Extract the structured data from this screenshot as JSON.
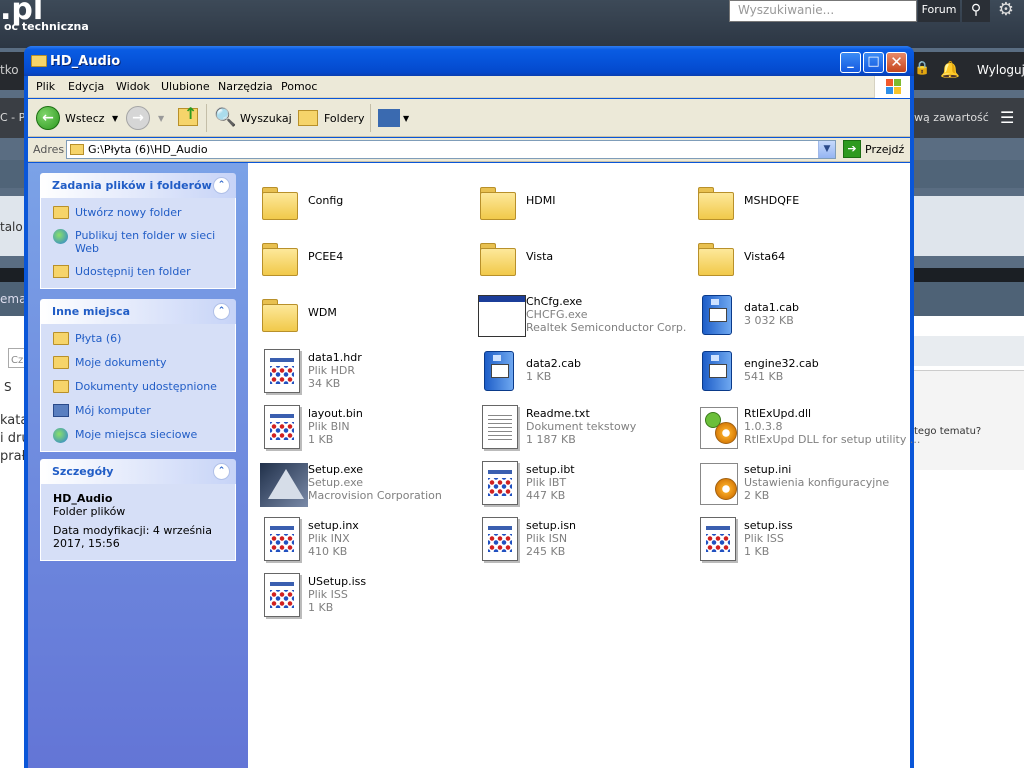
{
  "background_page": {
    "logo_text": ".pl",
    "logo_subtext": "oc techniczna",
    "search_placeholder": "Wyszukiwanie...",
    "forum_button": "Forum",
    "nav_left_text": "tko",
    "logout": "Wyloguj",
    "nav2_left_text": "C - Po",
    "nav2_right_text": "wą zawartość",
    "content_a_text": "talo",
    "stripe2_text": "ema",
    "left_snippet_1": "Cz",
    "left_snippet_2": "S",
    "left_snippet_3": "kata",
    "left_snippet_4": "i dru",
    "left_snippet_5": "prał",
    "right_snippet": "tego tematu?"
  },
  "window": {
    "title": "HD_Audio",
    "menu": [
      "Plik",
      "Edycja",
      "Widok",
      "Ulubione",
      "Narzędzia",
      "Pomoc"
    ],
    "toolbar": {
      "back": "Wstecz",
      "search": "Wyszukaj",
      "folders": "Foldery"
    },
    "address": {
      "label": "Adres",
      "path": "G:\\Płyta (6)\\HD_Audio",
      "go": "Przejdź"
    },
    "taskpane": {
      "file_tasks": {
        "title": "Zadania plików i folderów",
        "items": [
          "Utwórz nowy folder",
          "Publikuj ten folder w sieci Web",
          "Udostępnij ten folder"
        ]
      },
      "other_places": {
        "title": "Inne miejsca",
        "items": [
          "Płyta (6)",
          "Moje dokumenty",
          "Dokumenty udostępnione",
          "Mój komputer",
          "Moje miejsca sieciowe"
        ]
      },
      "details": {
        "title": "Szczegóły",
        "name": "HD_Audio",
        "type": "Folder plików",
        "modified": "Data modyfikacji: 4 września 2017, 15:56"
      }
    },
    "files": [
      {
        "name": "Config",
        "line2": "",
        "line3": "",
        "icon": "folder"
      },
      {
        "name": "HDMI",
        "line2": "",
        "line3": "",
        "icon": "folder"
      },
      {
        "name": "MSHDQFE",
        "line2": "",
        "line3": "",
        "icon": "folder"
      },
      {
        "name": "PCEE4",
        "line2": "",
        "line3": "",
        "icon": "folder"
      },
      {
        "name": "Vista",
        "line2": "",
        "line3": "",
        "icon": "folder"
      },
      {
        "name": "Vista64",
        "line2": "",
        "line3": "",
        "icon": "folder"
      },
      {
        "name": "WDM",
        "line2": "",
        "line3": "",
        "icon": "folder"
      },
      {
        "name": "ChCfg.exe",
        "line2": "CHCFG.exe",
        "line3": "Realtek Semiconductor Corp.",
        "icon": "app"
      },
      {
        "name": "data1.cab",
        "line2": "3 032 KB",
        "line3": "",
        "icon": "cab"
      },
      {
        "name": "data1.hdr",
        "line2": "Plik HDR",
        "line3": "34 KB",
        "icon": "generic"
      },
      {
        "name": "data2.cab",
        "line2": "1 KB",
        "line3": "",
        "icon": "cab"
      },
      {
        "name": "engine32.cab",
        "line2": "541 KB",
        "line3": "",
        "icon": "cab"
      },
      {
        "name": "layout.bin",
        "line2": "Plik BIN",
        "line3": "1 KB",
        "icon": "generic"
      },
      {
        "name": "Readme.txt",
        "line2": "Dokument tekstowy",
        "line3": "1 187 KB",
        "icon": "text"
      },
      {
        "name": "RtlExUpd.dll",
        "line2": "1.0.3.8",
        "line3": "RtlExUpd DLL for setup utility ...",
        "icon": "dll"
      },
      {
        "name": "Setup.exe",
        "line2": "Setup.exe",
        "line3": "Macrovision Corporation",
        "icon": "setup"
      },
      {
        "name": "setup.ibt",
        "line2": "Plik IBT",
        "line3": "447 KB",
        "icon": "generic"
      },
      {
        "name": "setup.ini",
        "line2": "Ustawienia konfiguracyjne",
        "line3": "2 KB",
        "icon": "ini"
      },
      {
        "name": "setup.inx",
        "line2": "Plik INX",
        "line3": "410 KB",
        "icon": "generic"
      },
      {
        "name": "setup.isn",
        "line2": "Plik ISN",
        "line3": "245 KB",
        "icon": "generic"
      },
      {
        "name": "setup.iss",
        "line2": "Plik ISS",
        "line3": "1 KB",
        "icon": "generic"
      },
      {
        "name": "USetup.iss",
        "line2": "Plik ISS",
        "line3": "1 KB",
        "icon": "generic"
      }
    ]
  }
}
